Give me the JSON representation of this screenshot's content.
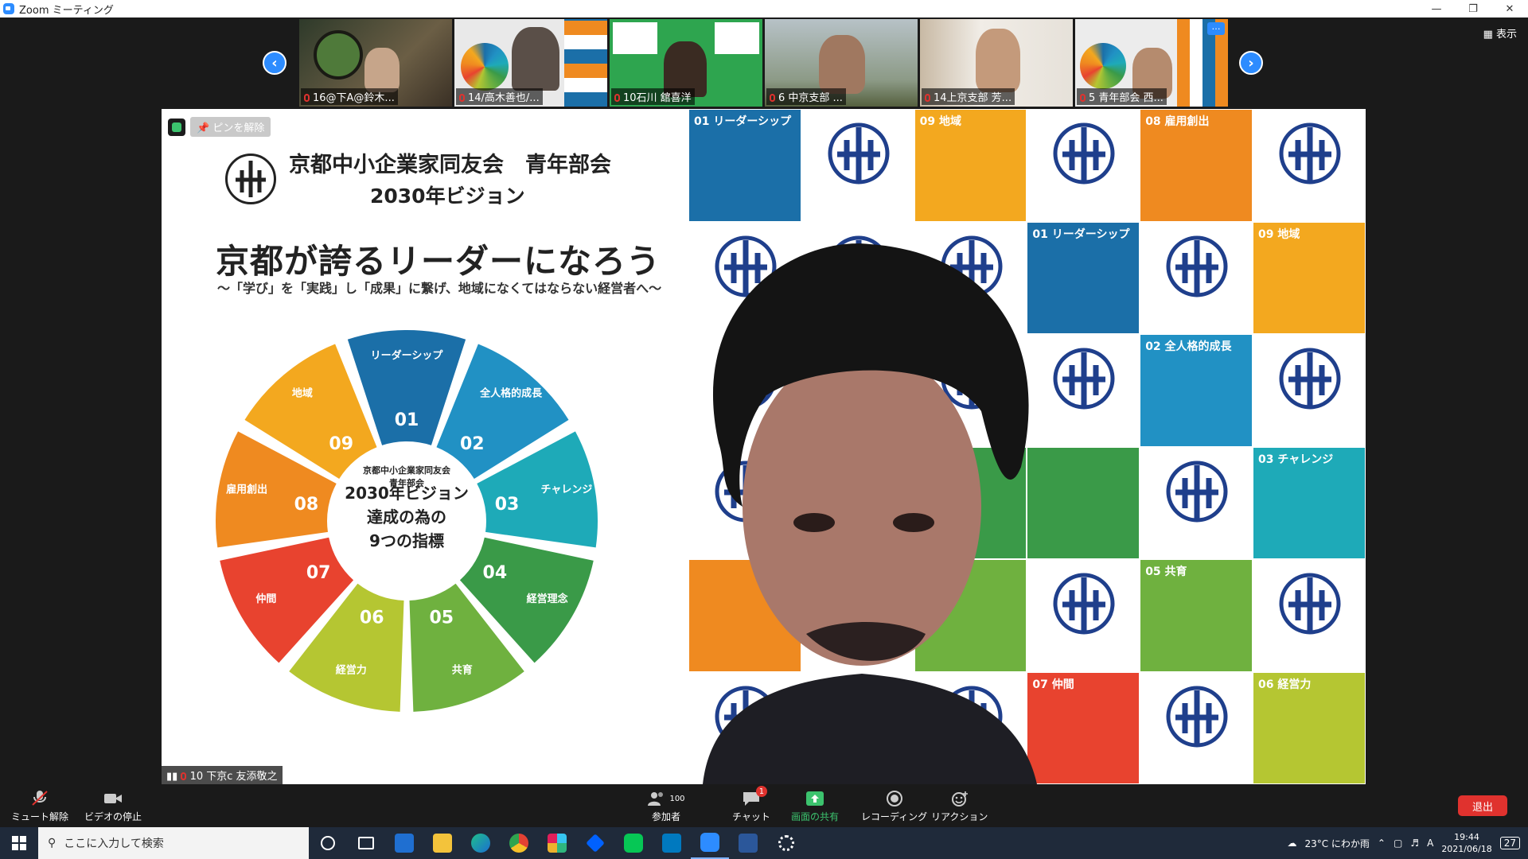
{
  "window": {
    "title": "Zoom ミーティング",
    "controls": [
      "minimize",
      "restore",
      "close"
    ]
  },
  "filmstrip": {
    "prev_icon": "chevron-left-icon",
    "next_icon": "chevron-right-icon",
    "view_label": "表示",
    "participants": [
      {
        "name": "16@下A@鈴木..."
      },
      {
        "name": "14/高木善也/..."
      },
      {
        "name": "10石川 舘喜洋"
      },
      {
        "name": "6 中京支部 ..."
      },
      {
        "name": "14上京支部 芳..."
      },
      {
        "name": "5 青年部会 西..."
      }
    ]
  },
  "stage": {
    "pin_label": "ピンを解除",
    "speaker_name": "10 下京c 友添敬之",
    "slide": {
      "org_title": "京都中小企業家同友会　青年部会",
      "vision_title": "2030年ビジョン",
      "headline": "京都が誇るリーダーになろう",
      "tagline": "〜「学び」を「実践」し「成果」に繋げ、地域になくてはならない経営者へ〜",
      "wheel_center": [
        "京都中小企業家同友会",
        "青年部会",
        "2030年ビジョン",
        "達成の為の",
        "9つの指標"
      ],
      "wheel_segments": [
        {
          "num": "01",
          "label": "リーダーシップ",
          "color": "#1b6fa8"
        },
        {
          "num": "02",
          "label": "全人格的成長",
          "color": "#2191c4"
        },
        {
          "num": "03",
          "label": "チャレンジ",
          "color": "#1eaab8"
        },
        {
          "num": "04",
          "label": "経営理念",
          "color": "#3a9a48"
        },
        {
          "num": "05",
          "label": "共育",
          "color": "#6fb13f"
        },
        {
          "num": "06",
          "label": "経営力",
          "color": "#b5c632"
        },
        {
          "num": "07",
          "label": "仲間",
          "color": "#e8432f"
        },
        {
          "num": "08",
          "label": "雇用創出",
          "color": "#ef8a20"
        },
        {
          "num": "09",
          "label": "地域",
          "color": "#f3a81f"
        }
      ]
    },
    "grid_tiles": [
      {
        "label": "01 リーダーシップ",
        "color": "#1b6fa8"
      },
      {
        "label": "",
        "color": "#ffffff"
      },
      {
        "label": "09 地域",
        "color": "#f3a81f"
      },
      {
        "label": "",
        "color": "#ffffff"
      },
      {
        "label": "08 雇用創出",
        "color": "#ef8a20"
      },
      {
        "label": "",
        "color": "#ffffff"
      },
      {
        "label": "",
        "color": "#ffffff"
      },
      {
        "label": "",
        "color": "#ffffff"
      },
      {
        "label": "",
        "color": "#ffffff"
      },
      {
        "label": "01 リーダーシップ",
        "color": "#1b6fa8"
      },
      {
        "label": "",
        "color": "#ffffff"
      },
      {
        "label": "09 地域",
        "color": "#f3a81f"
      },
      {
        "label": "",
        "color": "#ffffff"
      },
      {
        "label": "",
        "color": "#ffffff"
      },
      {
        "label": "",
        "color": "#ffffff"
      },
      {
        "label": "",
        "color": "#ffffff"
      },
      {
        "label": "02 全人格的成長",
        "color": "#2191c4"
      },
      {
        "label": "",
        "color": "#ffffff"
      },
      {
        "label": "",
        "color": "#ffffff"
      },
      {
        "label": "",
        "color": "#ffffff"
      },
      {
        "label": "",
        "color": "#3a9a48"
      },
      {
        "label": "",
        "color": "#3a9a48"
      },
      {
        "label": "",
        "color": "#ffffff"
      },
      {
        "label": "03 チャレンジ",
        "color": "#1eaab8"
      },
      {
        "label": "",
        "color": "#ef8a20"
      },
      {
        "label": "",
        "color": "#ffffff"
      },
      {
        "label": "",
        "color": "#6fb13f"
      },
      {
        "label": "",
        "color": "#ffffff"
      },
      {
        "label": "05 共育",
        "color": "#6fb13f"
      },
      {
        "label": "",
        "color": "#ffffff"
      },
      {
        "label": "",
        "color": "#ffffff"
      },
      {
        "label": "",
        "color": "#ffffff"
      },
      {
        "label": "",
        "color": "#ffffff"
      },
      {
        "label": "07 仲間",
        "color": "#e8432f"
      },
      {
        "label": "",
        "color": "#ffffff"
      },
      {
        "label": "06 経営力",
        "color": "#b5c632"
      }
    ]
  },
  "controls": {
    "mute_label": "ミュート解除",
    "video_label": "ビデオの停止",
    "participants_label": "参加者",
    "participants_count": "100",
    "chat_label": "チャット",
    "chat_badge": "1",
    "share_label": "画面の共有",
    "record_label": "レコーディング",
    "reactions_label": "リアクション",
    "leave_label": "退出"
  },
  "taskbar": {
    "search_placeholder": "ここに入力して検索",
    "weather": "23°C にわか雨",
    "ime": "A",
    "time": "19:44",
    "date": "2021/06/18",
    "notification_count": "27"
  },
  "colors": {
    "zoom_blue": "#2d8cff",
    "leave_red": "#e0322e",
    "share_green": "#3cc36e"
  }
}
